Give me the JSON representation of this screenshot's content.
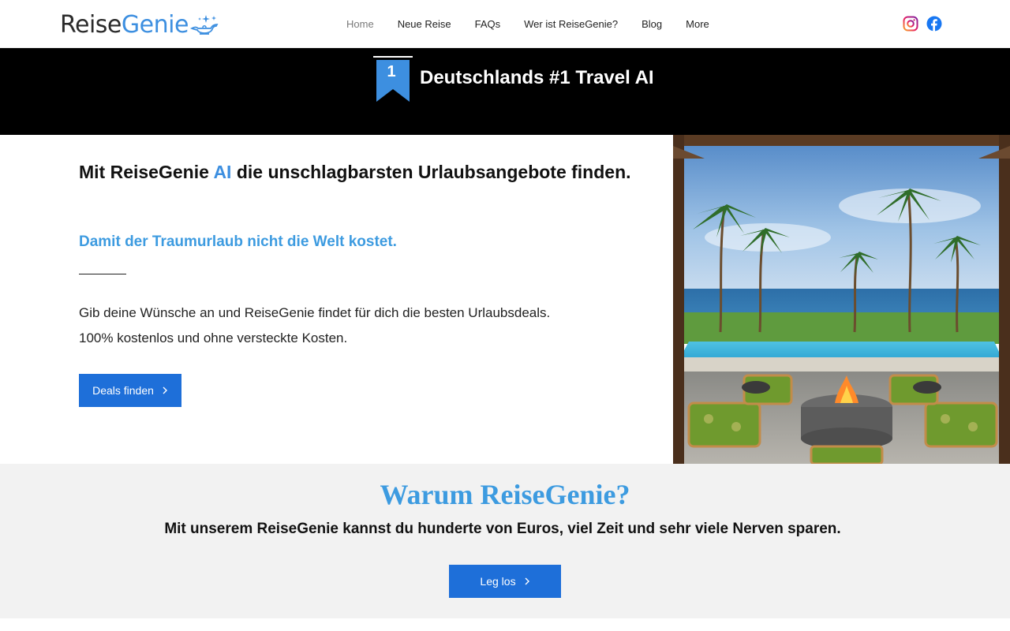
{
  "header": {
    "logo": {
      "part1": "Reise",
      "part2": "Genie"
    },
    "nav": [
      {
        "label": "Home",
        "active": true
      },
      {
        "label": "Neue Reise"
      },
      {
        "label": "FAQs"
      },
      {
        "label": "Wer ist ReiseGenie?"
      },
      {
        "label": "Blog"
      },
      {
        "label": "More"
      }
    ],
    "social": [
      "instagram-icon",
      "facebook-icon"
    ]
  },
  "banner": {
    "rank": "1",
    "title": "Deutschlands #1 Travel AI"
  },
  "hero": {
    "heading_pre": "Mit ReiseGenie ",
    "heading_accent": "AI",
    "heading_post": " die unschlagbarsten Urlaubsangebote finden.",
    "subheading": "Damit der Traumurlaub nicht die Welt kostet.",
    "body_line1": "Gib deine Wünsche an und ReiseGenie findet für dich die besten Urlaubsdeals.",
    "body_line2": "100% kostenlos und ohne versteckte Kosten.",
    "cta": "Deals finden"
  },
  "why": {
    "title": "Warum ReiseGenie?",
    "text": "Mit unserem ReiseGenie kannst du hunderte von Euros, viel Zeit und sehr viele Nerven sparen.",
    "cta": "Leg los"
  },
  "colors": {
    "accent": "#3d8fe0",
    "button": "#1e6fd9",
    "banner_bg": "#000000",
    "section_bg": "#f2f2f2"
  }
}
